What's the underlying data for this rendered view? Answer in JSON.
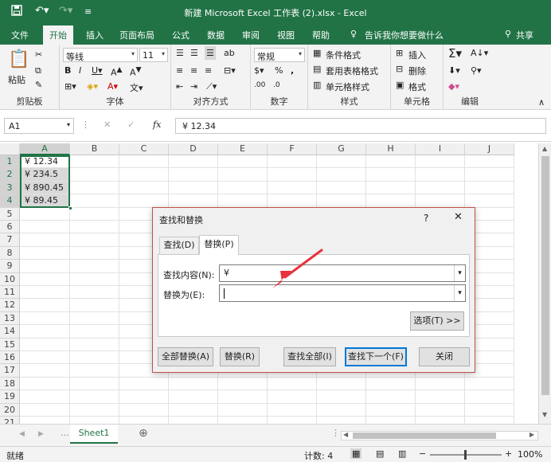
{
  "window": {
    "title": "新建 Microsoft Excel 工作表 (2).xlsx - Excel"
  },
  "ribbon_tabs": [
    "文件",
    "开始",
    "插入",
    "页面布局",
    "公式",
    "数据",
    "审阅",
    "视图",
    "帮助"
  ],
  "tell_me": "告诉我你想要做什么",
  "share": "共享",
  "ribbon": {
    "clipboard": {
      "paste": "粘贴",
      "label": "剪贴板"
    },
    "font": {
      "name": "等线",
      "size": "11",
      "label": "字体"
    },
    "alignment": {
      "label": "对齐方式"
    },
    "number": {
      "format": "常规",
      "label": "数字"
    },
    "styles": {
      "conditional": "条件格式",
      "table": "套用表格格式",
      "cell": "单元格样式",
      "label": "样式"
    },
    "cells": {
      "insert": "插入",
      "delete": "删除",
      "format": "格式",
      "label": "单元格"
    },
    "editing": {
      "label": "编辑"
    }
  },
  "formula_bar": {
    "name_box": "A1",
    "formula": "¥ 12.34"
  },
  "columns": [
    "A",
    "B",
    "C",
    "D",
    "E",
    "F",
    "G",
    "H",
    "I",
    "J"
  ],
  "rows": [
    "1",
    "2",
    "3",
    "4",
    "5",
    "6",
    "7",
    "8",
    "9",
    "10",
    "11",
    "12",
    "13",
    "14",
    "15",
    "16",
    "17",
    "18",
    "19",
    "20",
    "21"
  ],
  "cells": [
    "¥ 12.34",
    "¥ 234.5",
    "¥ 890.45",
    "¥ 89.45"
  ],
  "dialog": {
    "title": "查找和替换",
    "help": "?",
    "tab_find": "查找(D)",
    "tab_replace": "替换(P)",
    "find_label": "查找内容(N):",
    "find_value": "¥",
    "replace_label": "替换为(E):",
    "replace_value": "",
    "options_btn": "选项(T) >>",
    "replace_all": "全部替换(A)",
    "replace": "替换(R)",
    "find_all": "查找全部(I)",
    "find_next": "查找下一个(F)",
    "close": "关闭"
  },
  "sheet_tab": "Sheet1",
  "status": {
    "ready": "就绪",
    "count": "计数: 4",
    "zoom": "100%"
  },
  "colors": {
    "excel_green": "#217346",
    "arrow_red": "#e8323c",
    "dialog_border": "#c2504a"
  }
}
